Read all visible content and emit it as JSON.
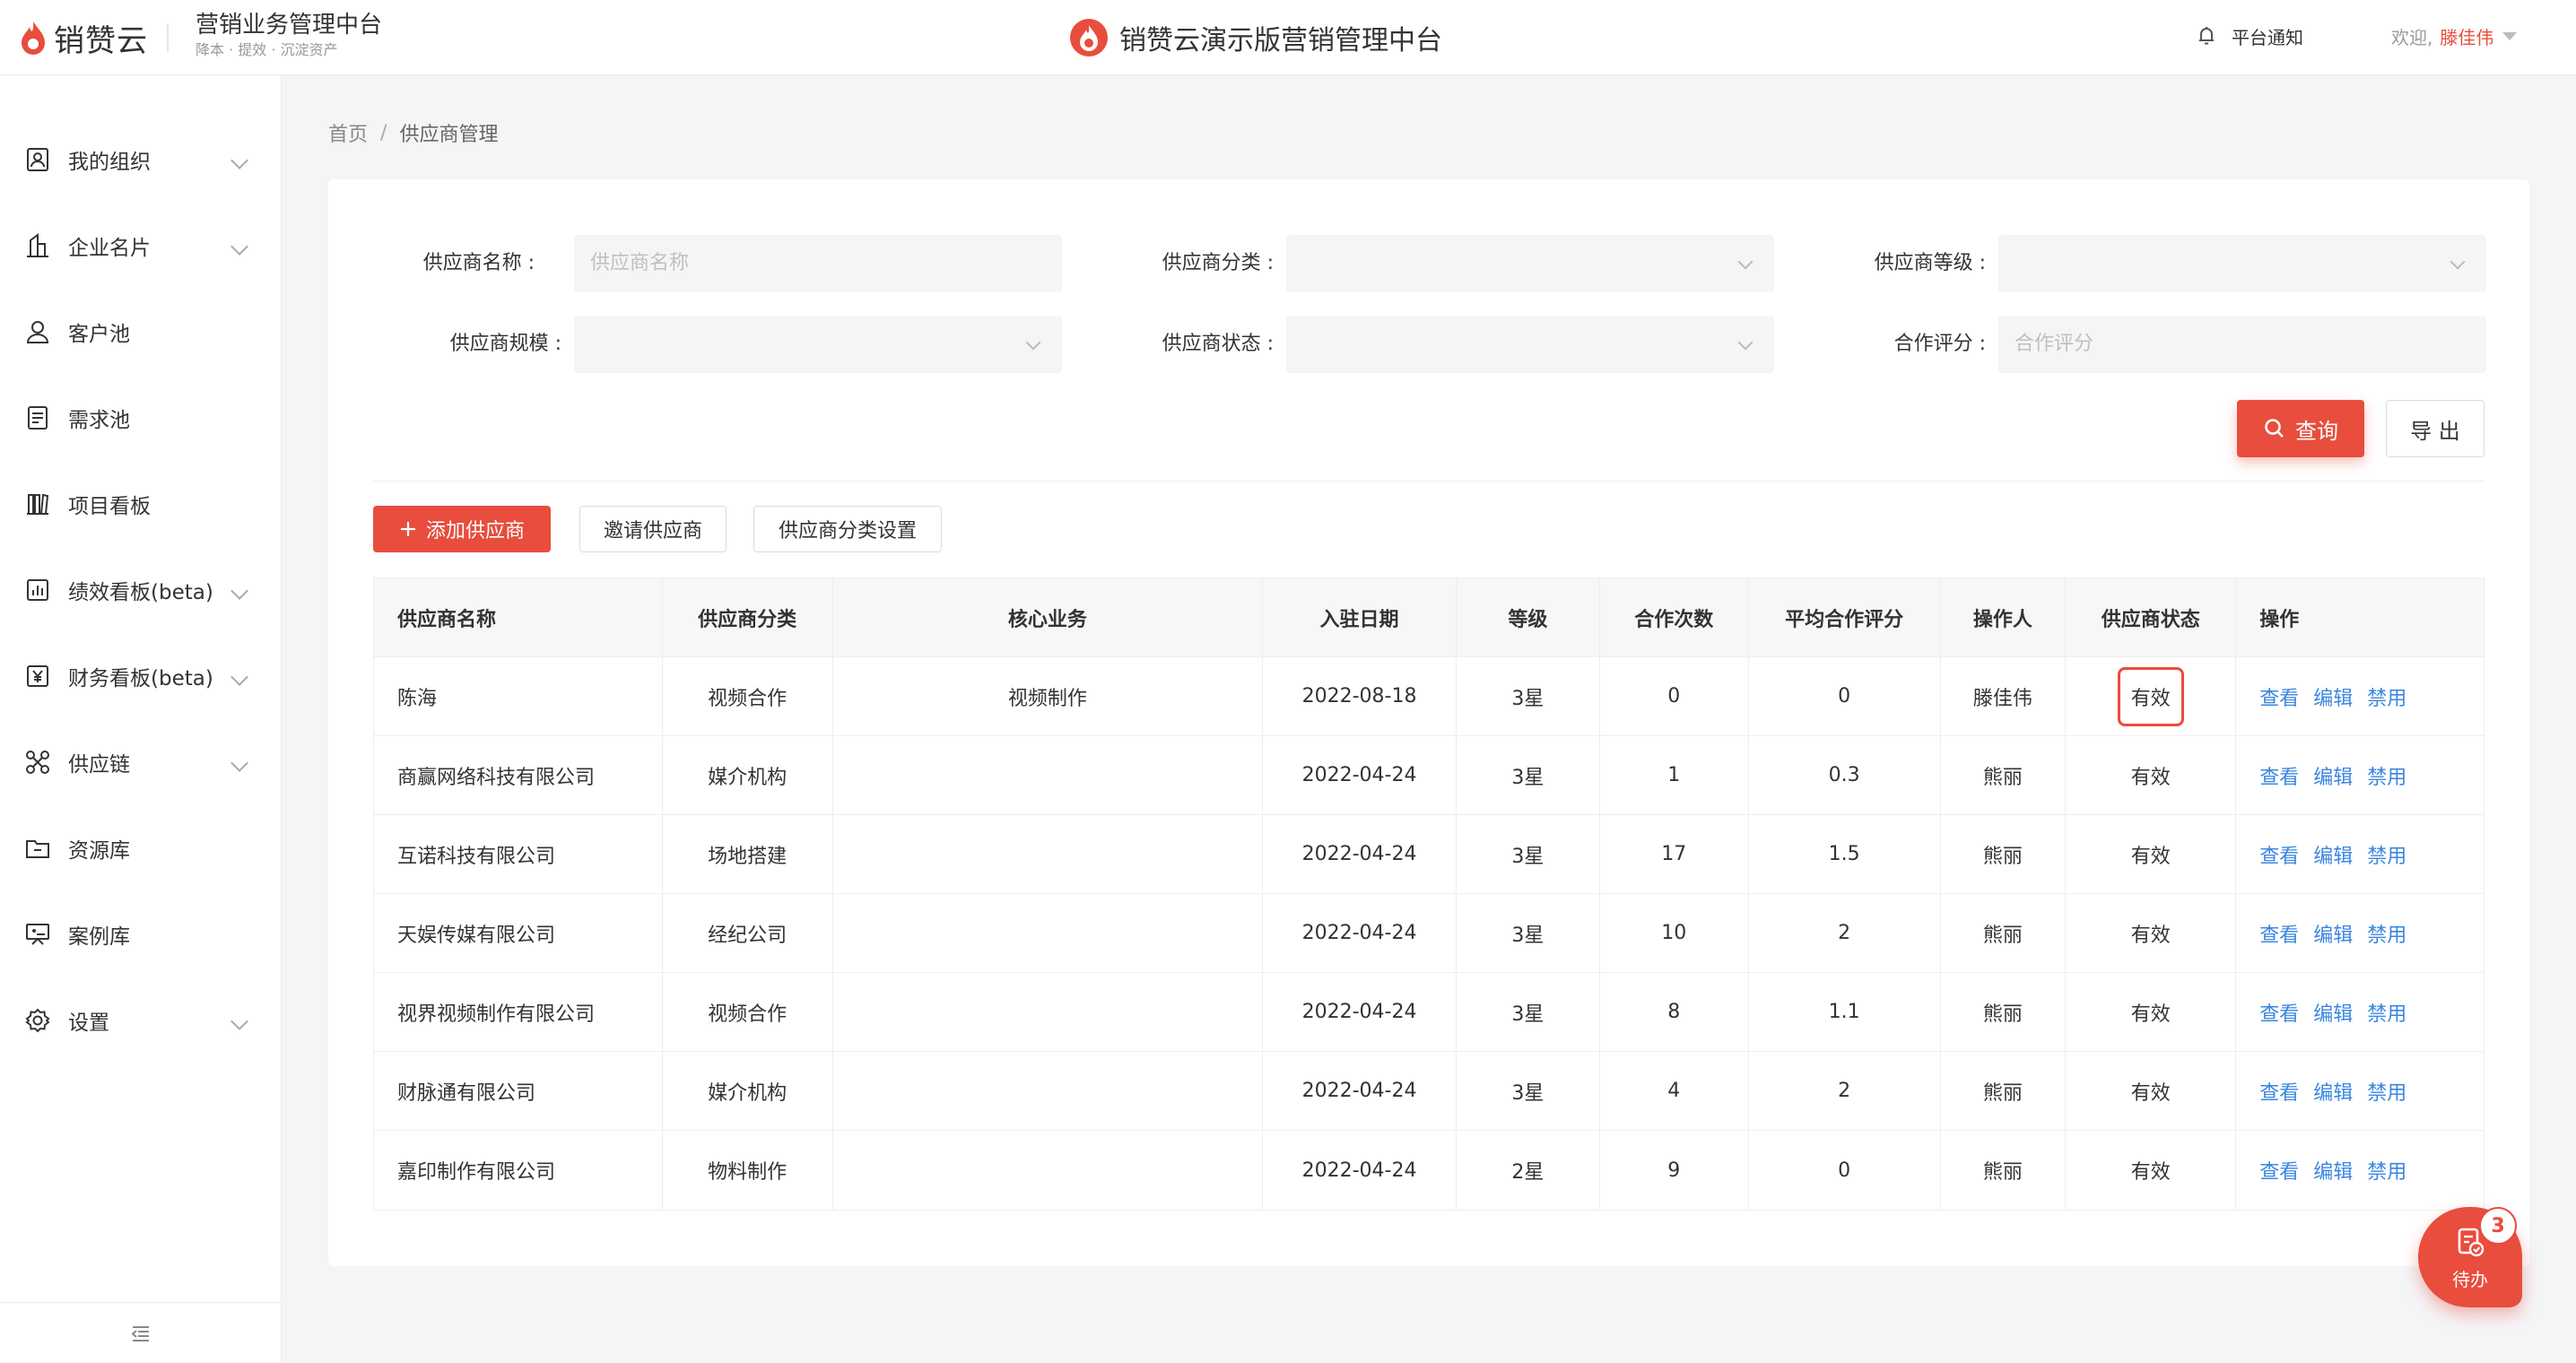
{
  "brand": {
    "logo_text": "销赞云",
    "tagline_title": "营销业务管理中台",
    "tagline_sub": "降本 · 提效 · 沉淀资产"
  },
  "header": {
    "center_title": "销赞云演示版营销管理中台",
    "notice_label": "平台通知",
    "welcome_label": "欢迎,",
    "user_name": "滕佳伟"
  },
  "sidebar": {
    "items": [
      {
        "label": "我的组织",
        "icon": "org-icon",
        "has_children": true
      },
      {
        "label": "企业名片",
        "icon": "building-icon",
        "has_children": true
      },
      {
        "label": "客户池",
        "icon": "user-icon",
        "has_children": false
      },
      {
        "label": "需求池",
        "icon": "document-icon",
        "has_children": false
      },
      {
        "label": "项目看板",
        "icon": "board-icon",
        "has_children": false
      },
      {
        "label": "绩效看板(beta)",
        "icon": "chart-icon",
        "has_children": true
      },
      {
        "label": "财务看板(beta)",
        "icon": "yen-icon",
        "has_children": true
      },
      {
        "label": "供应链",
        "icon": "network-icon",
        "has_children": true
      },
      {
        "label": "资源库",
        "icon": "folder-icon",
        "has_children": false
      },
      {
        "label": "案例库",
        "icon": "presentation-icon",
        "has_children": false
      },
      {
        "label": "设置",
        "icon": "gear-icon",
        "has_children": true
      }
    ]
  },
  "breadcrumb": {
    "home": "首页",
    "separator": "/",
    "current": "供应商管理"
  },
  "filters": {
    "name_label": "供应商名称 :",
    "name_placeholder": "供应商名称",
    "category_label": "供应商分类 :",
    "level_label": "供应商等级 :",
    "scale_label": "供应商规模 :",
    "status_label": "供应商状态 :",
    "rating_label": "合作评分 :",
    "rating_placeholder": "合作评分"
  },
  "actions": {
    "query": "查询",
    "export": "导 出",
    "add": "添加供应商",
    "invite": "邀请供应商",
    "category_settings": "供应商分类设置"
  },
  "table": {
    "columns": [
      "供应商名称",
      "供应商分类",
      "核心业务",
      "入驻日期",
      "等级",
      "合作次数",
      "平均合作评分",
      "操作人",
      "供应商状态",
      "操作"
    ],
    "ops": {
      "view": "查看",
      "edit": "编辑",
      "disable": "禁用"
    },
    "rows": [
      {
        "name": "陈海",
        "category": "视频合作",
        "core": "视频制作",
        "date": "2022-08-18",
        "level": "3星",
        "count": "0",
        "rating": "0",
        "operator": "滕佳伟",
        "status": "有效"
      },
      {
        "name": "商赢网络科技有限公司",
        "category": "媒介机构",
        "core": "",
        "date": "2022-04-24",
        "level": "3星",
        "count": "1",
        "rating": "0.3",
        "operator": "熊丽",
        "status": "有效"
      },
      {
        "name": "互诺科技有限公司",
        "category": "场地搭建",
        "core": "",
        "date": "2022-04-24",
        "level": "3星",
        "count": "17",
        "rating": "1.5",
        "operator": "熊丽",
        "status": "有效"
      },
      {
        "name": "天娱传媒有限公司",
        "category": "经纪公司",
        "core": "",
        "date": "2022-04-24",
        "level": "3星",
        "count": "10",
        "rating": "2",
        "operator": "熊丽",
        "status": "有效"
      },
      {
        "name": "视界视频制作有限公司",
        "category": "视频合作",
        "core": "",
        "date": "2022-04-24",
        "level": "3星",
        "count": "8",
        "rating": "1.1",
        "operator": "熊丽",
        "status": "有效"
      },
      {
        "name": "财脉通有限公司",
        "category": "媒介机构",
        "core": "",
        "date": "2022-04-24",
        "level": "3星",
        "count": "4",
        "rating": "2",
        "operator": "熊丽",
        "status": "有效"
      },
      {
        "name": "嘉印制作有限公司",
        "category": "物料制作",
        "core": "",
        "date": "2022-04-24",
        "level": "2星",
        "count": "9",
        "rating": "0",
        "operator": "熊丽",
        "status": "有效"
      }
    ]
  },
  "todo": {
    "label": "待办",
    "badge": "3"
  },
  "colors": {
    "accent": "#e84d3d",
    "link": "#3a86e0"
  }
}
